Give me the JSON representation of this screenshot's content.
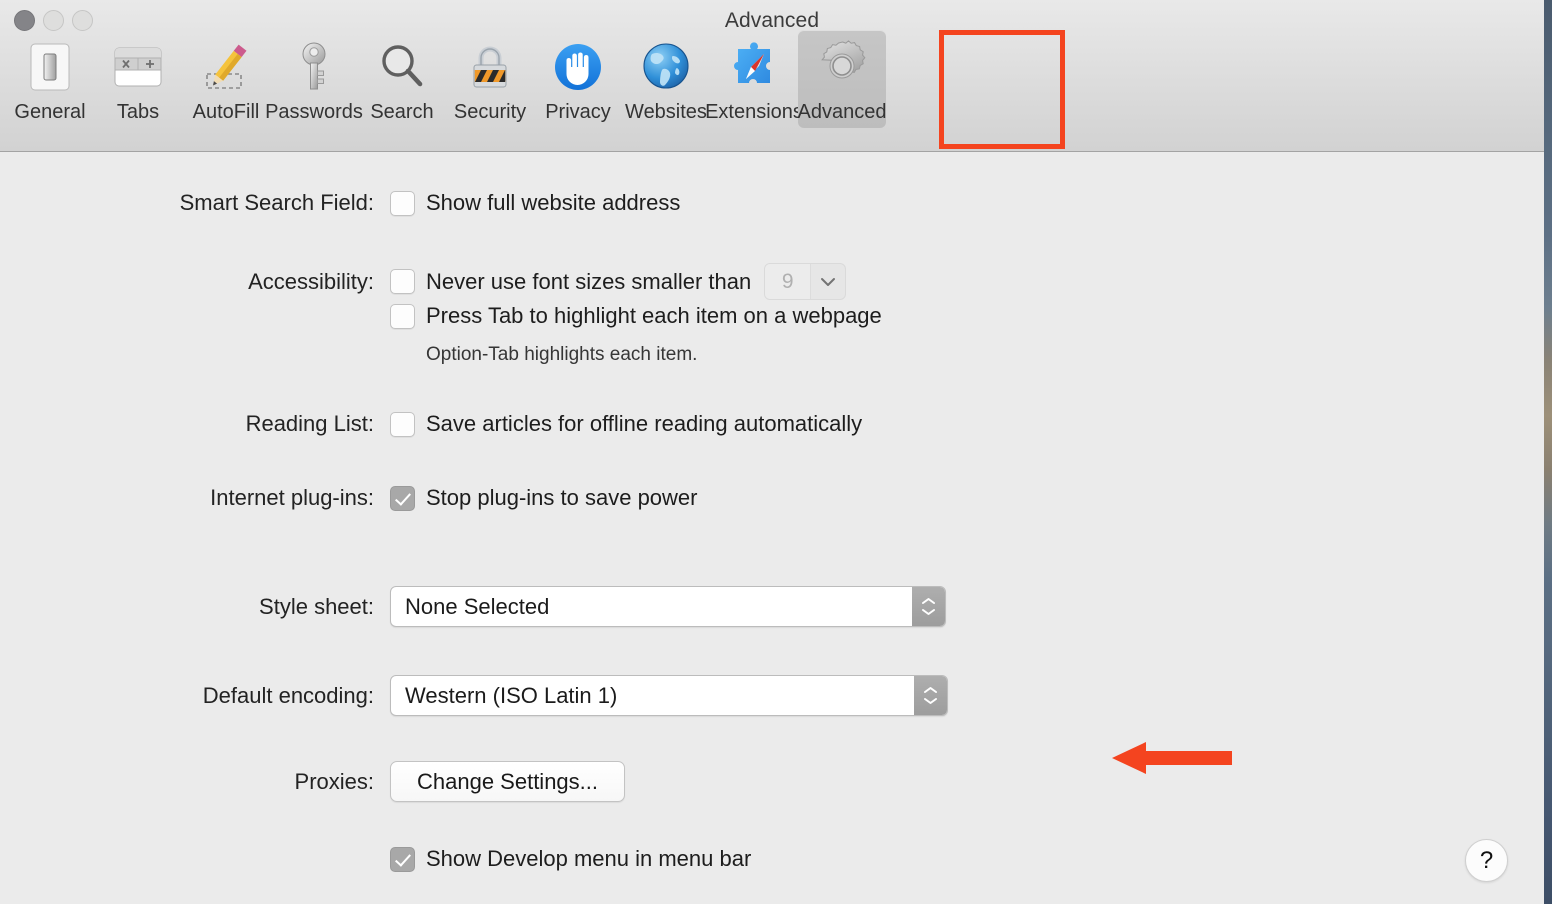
{
  "window": {
    "title": "Advanced",
    "traffic_lights": [
      "close-button",
      "minimize-button",
      "zoom-button"
    ]
  },
  "toolbar": {
    "items": [
      {
        "label": "General",
        "icon": "general-switch-icon",
        "selected": false
      },
      {
        "label": "Tabs",
        "icon": "tabs-window-icon",
        "selected": false
      },
      {
        "label": "AutoFill",
        "icon": "autofill-pencil-icon",
        "selected": false
      },
      {
        "label": "Passwords",
        "icon": "passwords-key-icon",
        "selected": false
      },
      {
        "label": "Search",
        "icon": "search-magnifier-icon",
        "selected": false
      },
      {
        "label": "Security",
        "icon": "security-padlock-icon",
        "selected": false
      },
      {
        "label": "Privacy",
        "icon": "privacy-hand-icon",
        "selected": false
      },
      {
        "label": "Websites",
        "icon": "websites-globe-icon",
        "selected": false
      },
      {
        "label": "Extensions",
        "icon": "extensions-puzzle-icon",
        "selected": false
      },
      {
        "label": "Advanced",
        "icon": "advanced-gear-icon",
        "selected": true
      }
    ]
  },
  "settings": {
    "smart_search_field": {
      "label": "Smart Search Field:",
      "show_full_address": {
        "text": "Show full website address",
        "checked": false
      }
    },
    "accessibility": {
      "label": "Accessibility:",
      "min_font": {
        "text": "Never use font sizes smaller than",
        "checked": false
      },
      "min_font_value": "9",
      "press_tab": {
        "text": "Press Tab to highlight each item on a webpage",
        "checked": false
      },
      "hint": "Option-Tab highlights each item."
    },
    "reading_list": {
      "label": "Reading List:",
      "save_offline": {
        "text": "Save articles for offline reading automatically",
        "checked": false
      }
    },
    "internet_plugins": {
      "label": "Internet plug-ins:",
      "stop_plugins": {
        "text": "Stop plug-ins to save power",
        "checked": true
      }
    },
    "style_sheet": {
      "label": "Style sheet:",
      "value": "None Selected"
    },
    "default_encoding": {
      "label": "Default encoding:",
      "value": "Western (ISO Latin 1)"
    },
    "proxies": {
      "label": "Proxies:",
      "button": "Change Settings..."
    },
    "develop_menu": {
      "text": "Show Develop menu in menu bar",
      "checked": true
    }
  },
  "help": {
    "glyph": "?"
  },
  "annotations": {
    "highlight_box": {
      "target": "Advanced",
      "color": "#f4441f"
    },
    "arrow": {
      "target": "Style sheet popup stepper",
      "color": "#f4441f",
      "direction": "left"
    }
  }
}
